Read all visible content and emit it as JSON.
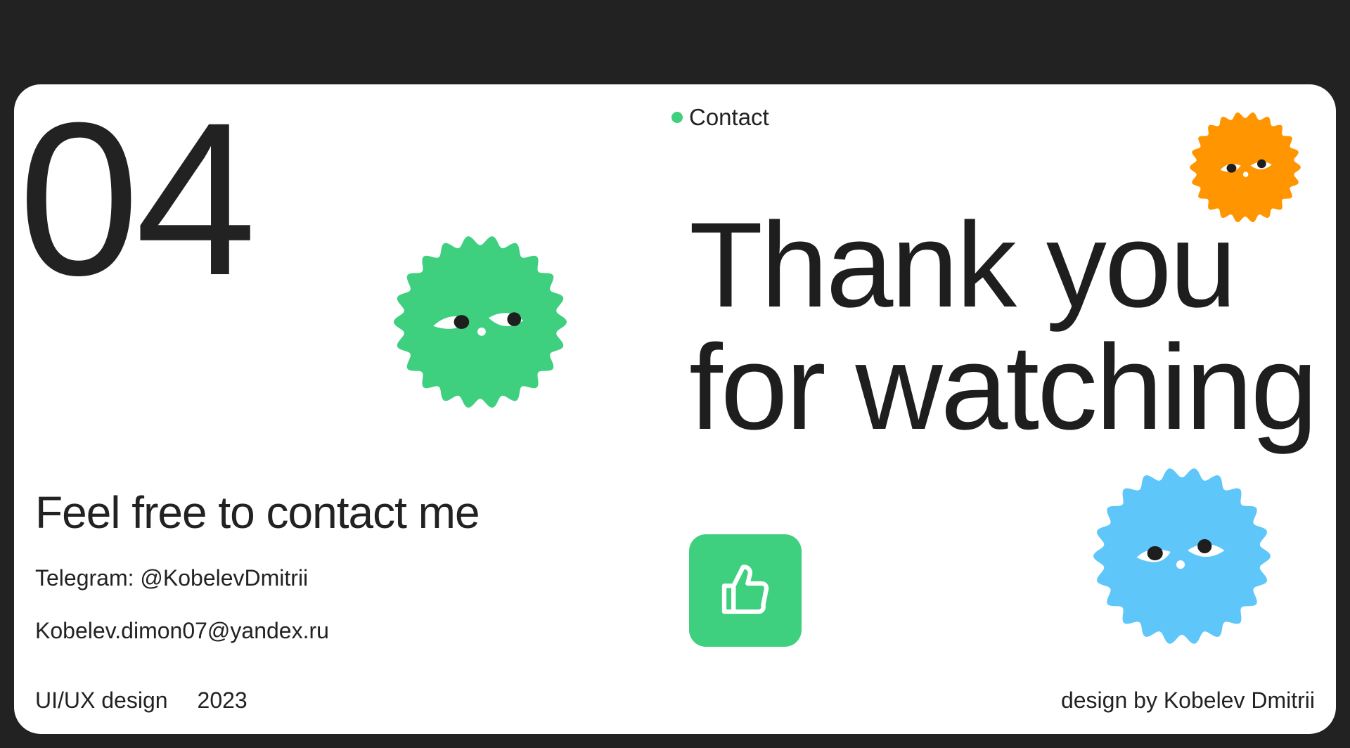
{
  "slide": {
    "number": "04",
    "section_label": "Contact",
    "headline_line1": "Thank you",
    "headline_line2": "for watching"
  },
  "contact": {
    "title": "Feel free to contact me",
    "telegram": "Telegram: @KobelevDmitrii",
    "email": "Kobelev.dimon07@yandex.ru"
  },
  "footer": {
    "category": "UI/UX design",
    "year": "2023",
    "credit": "design by Kobelev Dmitrii"
  },
  "colors": {
    "background": "#222222",
    "card": "#ffffff",
    "accent_green": "#3ecf7f",
    "blob_orange": "#ff9500",
    "blob_blue": "#5ec6f9",
    "text": "#222222"
  },
  "icons": {
    "like_button": "thumbs-up-icon",
    "mascots": [
      "green-blob-mascot",
      "orange-blob-mascot",
      "blue-blob-mascot"
    ]
  }
}
